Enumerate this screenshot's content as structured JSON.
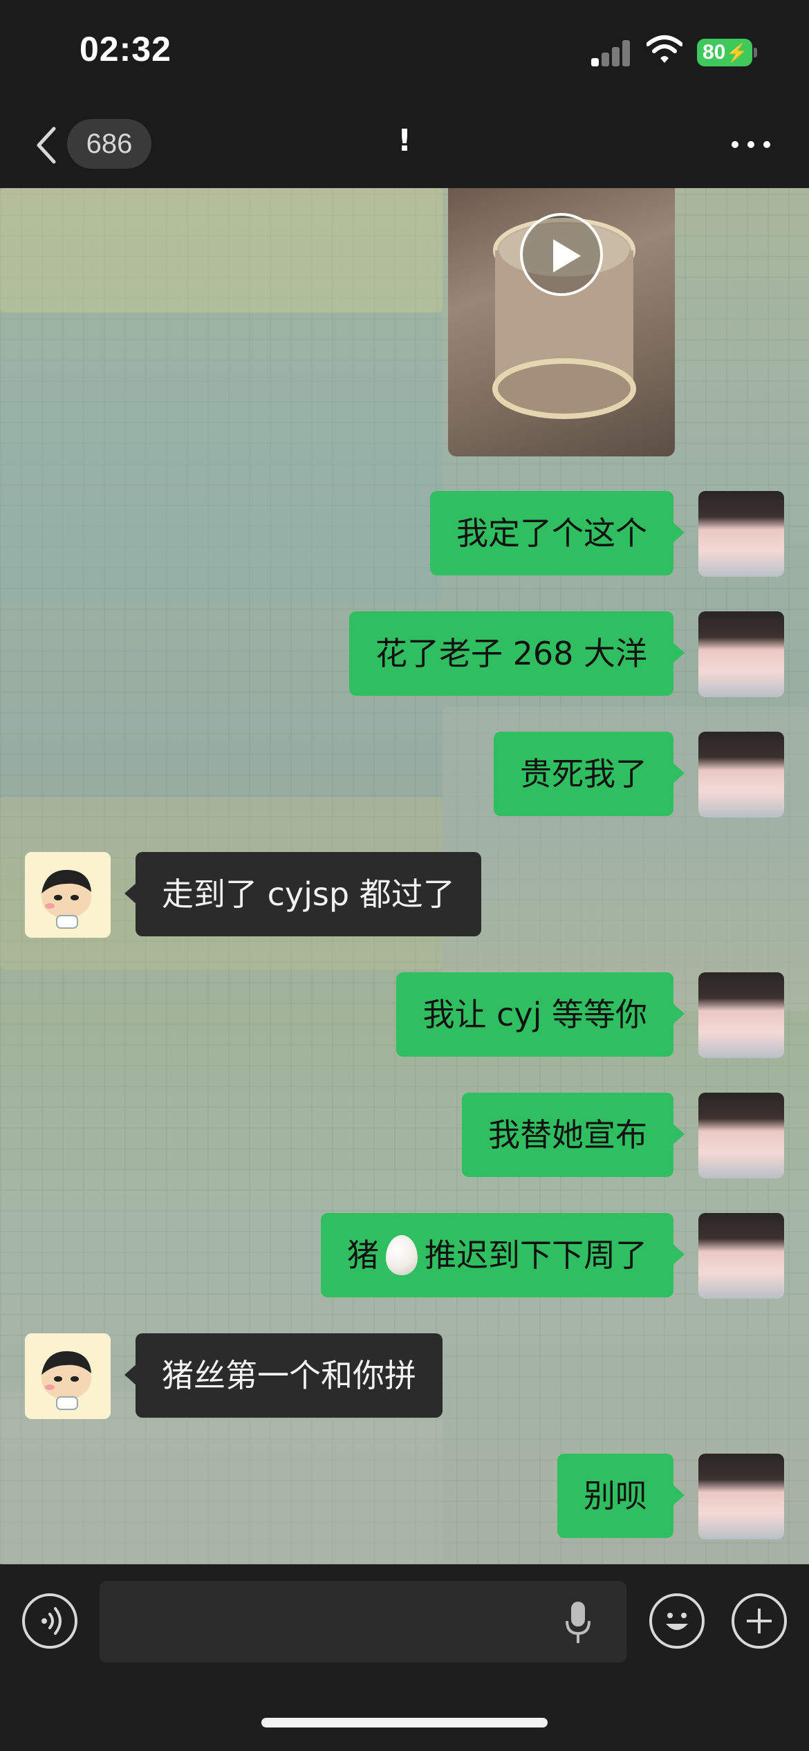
{
  "status_bar": {
    "time": "02:32",
    "battery_level": "80",
    "battery_color": "#3fc95a",
    "icons": [
      "signal-icon",
      "wifi-icon",
      "battery-icon",
      "charging-bolt-icon"
    ]
  },
  "nav": {
    "unread_count": "686",
    "title": "!",
    "icons": [
      "back-chevron-icon",
      "more-dots-icon"
    ]
  },
  "chat": {
    "video_message": {
      "sender": "me",
      "play_icon": "play-icon"
    },
    "messages": [
      {
        "sender": "me",
        "text": "我定了个这个"
      },
      {
        "sender": "me",
        "text": "花了老子 268 大洋"
      },
      {
        "sender": "me",
        "text": "贵死我了"
      },
      {
        "sender": "them",
        "text": "走到了 cyjsp 都过了"
      },
      {
        "sender": "me",
        "text": "我让 cyj 等等你"
      },
      {
        "sender": "me",
        "text": "我替她宣布"
      },
      {
        "sender": "me",
        "text_before": "猪",
        "emoji": "egg-emoji",
        "text_after": "推迟到下下周了"
      },
      {
        "sender": "them",
        "text": "猪丝第一个和你拼"
      },
      {
        "sender": "me",
        "text": "别呗"
      }
    ]
  },
  "input_bar": {
    "text_value": "",
    "icons": [
      "voice-icon",
      "microphone-icon",
      "emoji-icon",
      "plus-icon"
    ]
  },
  "colors": {
    "my_bubble": "#2fbf60",
    "their_bubble": "#2b2b2b",
    "bar_background": "#1b1b1b"
  }
}
